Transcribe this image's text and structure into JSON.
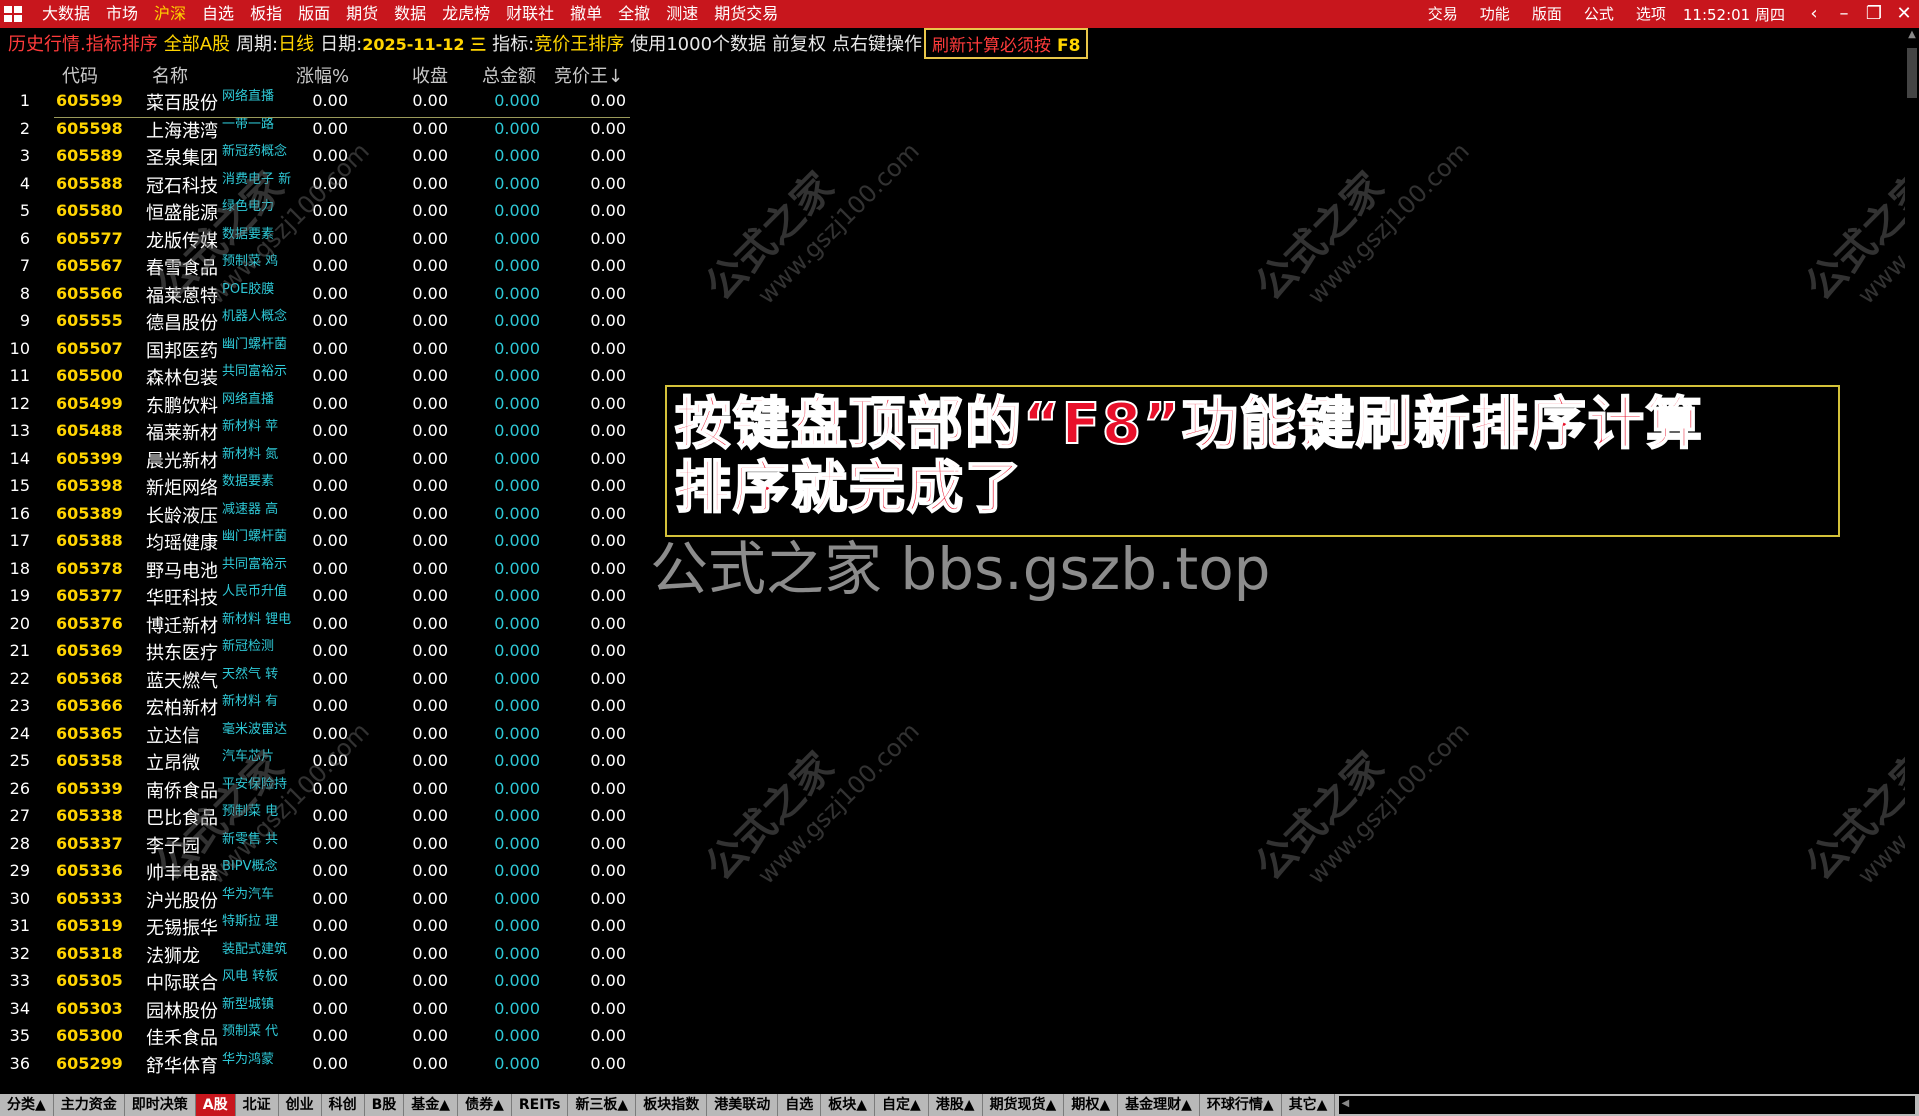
{
  "menubar": {
    "items": [
      "大数据",
      "市场",
      "沪深",
      "自选",
      "板指",
      "版面",
      "期货",
      "数据",
      "龙虎榜",
      "财联社",
      "撤单",
      "全撤",
      "测速",
      "期货交易"
    ],
    "active_index": 2,
    "right_items": [
      "交易",
      "功能",
      "版面",
      "公式",
      "选项"
    ],
    "clock": "11:52:01 周四"
  },
  "infobar": {
    "mode": "历史行情.指标排序",
    "scope": "全部A股",
    "period_label": "周期:",
    "period": "日线",
    "date_label": "日期:",
    "date": "2025-11-12 三",
    "indicator_label": "指标:",
    "indicator": "竞价王排序",
    "usage": "使用1000个数据",
    "adjust": "前复权",
    "hint": "点右键操作",
    "refresh": "刷新计算必须按",
    "refresh_key": "F8"
  },
  "table": {
    "headers": {
      "code": "代码",
      "name": "名称",
      "chg": "涨幅%",
      "close": "收盘",
      "amount": "总金额",
      "jjw": "竞价王↓"
    },
    "rows": [
      {
        "i": "1",
        "code": "605599",
        "name": "菜百股份",
        "concept": "网络直播",
        "chg": "0.00",
        "close": "0.00",
        "amount": "0.000",
        "jjw": "0.00"
      },
      {
        "i": "2",
        "code": "605598",
        "name": "上海港湾",
        "concept": "一带一路",
        "chg": "0.00",
        "close": "0.00",
        "amount": "0.000",
        "jjw": "0.00"
      },
      {
        "i": "3",
        "code": "605589",
        "name": "圣泉集团",
        "concept": "新冠药概念",
        "chg": "0.00",
        "close": "0.00",
        "amount": "0.000",
        "jjw": "0.00"
      },
      {
        "i": "4",
        "code": "605588",
        "name": "冠石科技",
        "concept": "消费电子 新",
        "chg": "0.00",
        "close": "0.00",
        "amount": "0.000",
        "jjw": "0.00"
      },
      {
        "i": "5",
        "code": "605580",
        "name": "恒盛能源",
        "concept": "绿色电力",
        "chg": "0.00",
        "close": "0.00",
        "amount": "0.000",
        "jjw": "0.00"
      },
      {
        "i": "6",
        "code": "605577",
        "name": "龙版传媒",
        "concept": "数据要素",
        "chg": "0.00",
        "close": "0.00",
        "amount": "0.000",
        "jjw": "0.00"
      },
      {
        "i": "7",
        "code": "605567",
        "name": "春雪食品",
        "concept": "预制菜 鸡",
        "chg": "0.00",
        "close": "0.00",
        "amount": "0.000",
        "jjw": "0.00"
      },
      {
        "i": "8",
        "code": "605566",
        "name": "福莱蒽特",
        "concept": "POE胶膜",
        "chg": "0.00",
        "close": "0.00",
        "amount": "0.000",
        "jjw": "0.00"
      },
      {
        "i": "9",
        "code": "605555",
        "name": "德昌股份",
        "concept": "机器人概念",
        "chg": "0.00",
        "close": "0.00",
        "amount": "0.000",
        "jjw": "0.00"
      },
      {
        "i": "10",
        "code": "605507",
        "name": "国邦医药",
        "concept": "幽门螺杆菌",
        "chg": "0.00",
        "close": "0.00",
        "amount": "0.000",
        "jjw": "0.00"
      },
      {
        "i": "11",
        "code": "605500",
        "name": "森林包装",
        "concept": "共同富裕示",
        "chg": "0.00",
        "close": "0.00",
        "amount": "0.000",
        "jjw": "0.00"
      },
      {
        "i": "12",
        "code": "605499",
        "name": "东鹏饮料",
        "concept": "网络直播",
        "chg": "0.00",
        "close": "0.00",
        "amount": "0.000",
        "jjw": "0.00"
      },
      {
        "i": "13",
        "code": "605488",
        "name": "福莱新材",
        "concept": "新材料 苹",
        "chg": "0.00",
        "close": "0.00",
        "amount": "0.000",
        "jjw": "0.00"
      },
      {
        "i": "14",
        "code": "605399",
        "name": "晨光新材",
        "concept": "新材料 氮",
        "chg": "0.00",
        "close": "0.00",
        "amount": "0.000",
        "jjw": "0.00"
      },
      {
        "i": "15",
        "code": "605398",
        "name": "新炬网络",
        "concept": "数据要素",
        "chg": "0.00",
        "close": "0.00",
        "amount": "0.000",
        "jjw": "0.00"
      },
      {
        "i": "16",
        "code": "605389",
        "name": "长龄液压",
        "concept": "减速器 高",
        "chg": "0.00",
        "close": "0.00",
        "amount": "0.000",
        "jjw": "0.00"
      },
      {
        "i": "17",
        "code": "605388",
        "name": "均瑶健康",
        "concept": "幽门螺杆菌",
        "chg": "0.00",
        "close": "0.00",
        "amount": "0.000",
        "jjw": "0.00"
      },
      {
        "i": "18",
        "code": "605378",
        "name": "野马电池",
        "concept": "共同富裕示",
        "chg": "0.00",
        "close": "0.00",
        "amount": "0.000",
        "jjw": "0.00"
      },
      {
        "i": "19",
        "code": "605377",
        "name": "华旺科技",
        "concept": "人民币升值",
        "chg": "0.00",
        "close": "0.00",
        "amount": "0.000",
        "jjw": "0.00"
      },
      {
        "i": "20",
        "code": "605376",
        "name": "博迁新材",
        "concept": "新材料 锂电",
        "chg": "0.00",
        "close": "0.00",
        "amount": "0.000",
        "jjw": "0.00"
      },
      {
        "i": "21",
        "code": "605369",
        "name": "拱东医疗",
        "concept": "新冠检测",
        "chg": "0.00",
        "close": "0.00",
        "amount": "0.000",
        "jjw": "0.00"
      },
      {
        "i": "22",
        "code": "605368",
        "name": "蓝天燃气",
        "concept": "天然气 转",
        "chg": "0.00",
        "close": "0.00",
        "amount": "0.000",
        "jjw": "0.00"
      },
      {
        "i": "23",
        "code": "605366",
        "name": "宏柏新材",
        "concept": "新材料 有",
        "chg": "0.00",
        "close": "0.00",
        "amount": "0.000",
        "jjw": "0.00"
      },
      {
        "i": "24",
        "code": "605365",
        "name": "立达信",
        "concept": "毫米波雷达",
        "chg": "0.00",
        "close": "0.00",
        "amount": "0.000",
        "jjw": "0.00"
      },
      {
        "i": "25",
        "code": "605358",
        "name": "立昂微",
        "concept": "汽车芯片",
        "chg": "0.00",
        "close": "0.00",
        "amount": "0.000",
        "jjw": "0.00"
      },
      {
        "i": "26",
        "code": "605339",
        "name": "南侨食品",
        "concept": "平安保险持",
        "chg": "0.00",
        "close": "0.00",
        "amount": "0.000",
        "jjw": "0.00"
      },
      {
        "i": "27",
        "code": "605338",
        "name": "巴比食品",
        "concept": "预制菜 电",
        "chg": "0.00",
        "close": "0.00",
        "amount": "0.000",
        "jjw": "0.00"
      },
      {
        "i": "28",
        "code": "605337",
        "name": "李子园",
        "concept": "新零售 共",
        "chg": "0.00",
        "close": "0.00",
        "amount": "0.000",
        "jjw": "0.00"
      },
      {
        "i": "29",
        "code": "605336",
        "name": "帅丰电器",
        "concept": "BIPV概念",
        "chg": "0.00",
        "close": "0.00",
        "amount": "0.000",
        "jjw": "0.00"
      },
      {
        "i": "30",
        "code": "605333",
        "name": "沪光股份",
        "concept": "华为汽车",
        "chg": "0.00",
        "close": "0.00",
        "amount": "0.000",
        "jjw": "0.00"
      },
      {
        "i": "31",
        "code": "605319",
        "name": "无锡振华",
        "concept": "特斯拉 理",
        "chg": "0.00",
        "close": "0.00",
        "amount": "0.000",
        "jjw": "0.00"
      },
      {
        "i": "32",
        "code": "605318",
        "name": "法狮龙",
        "concept": "装配式建筑",
        "chg": "0.00",
        "close": "0.00",
        "amount": "0.000",
        "jjw": "0.00"
      },
      {
        "i": "33",
        "code": "605305",
        "name": "中际联合",
        "concept": "风电 转板",
        "chg": "0.00",
        "close": "0.00",
        "amount": "0.000",
        "jjw": "0.00"
      },
      {
        "i": "34",
        "code": "605303",
        "name": "园林股份",
        "concept": "新型城镇",
        "chg": "0.00",
        "close": "0.00",
        "amount": "0.000",
        "jjw": "0.00"
      },
      {
        "i": "35",
        "code": "605300",
        "name": "佳禾食品",
        "concept": "预制菜 代",
        "chg": "0.00",
        "close": "0.00",
        "amount": "0.000",
        "jjw": "0.00"
      },
      {
        "i": "36",
        "code": "605299",
        "name": "舒华体育",
        "concept": "华为鸿蒙",
        "chg": "0.00",
        "close": "0.00",
        "amount": "0.000",
        "jjw": "0.00"
      }
    ]
  },
  "instruction": {
    "line1": "按键盘顶部的“F8”功能键刷新排序计算",
    "line2": "排序就完成了"
  },
  "forum": "公式之家 bbs.gszb.top",
  "watermark": {
    "title": "公式之家",
    "url": "www.gszj100.com"
  },
  "bottom_tabs": [
    "分类▲",
    "主力资金",
    "即时决策",
    "A股",
    "北证",
    "创业",
    "科创",
    "B股",
    "基金▲",
    "债券▲",
    "REITs",
    "新三板▲",
    "板块指数",
    "港美联动",
    "自选",
    "板块▲",
    "自定▲",
    "港股▲",
    "期货现货▲",
    "期权▲",
    "基金理财▲",
    "环球行情▲",
    "其它▲"
  ],
  "bottom_active_index": 3
}
